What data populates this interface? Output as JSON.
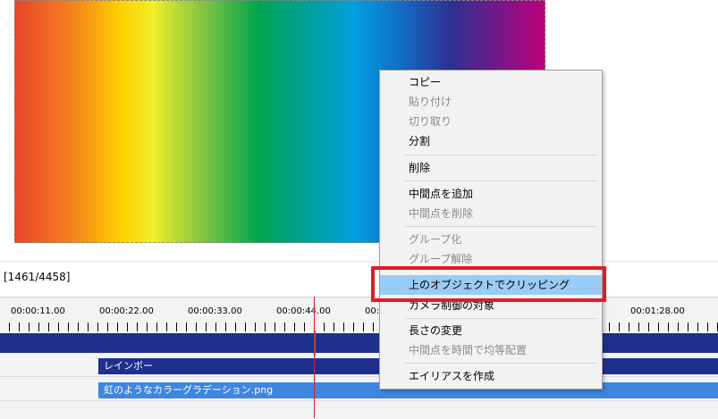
{
  "infobar": {
    "frame_counter": "[1461/4458]"
  },
  "ruler": {
    "labels": [
      "00:00:11.00",
      "00:00:22.00",
      "00:00:33.00",
      "00:00:44.00",
      "00:",
      "00:01:28.00"
    ]
  },
  "clips": {
    "rainbow": "レインボー",
    "png": "虹のようなカラーグラデーション.png"
  },
  "menu": {
    "items": [
      {
        "label": "コピー",
        "enabled": true
      },
      {
        "label": "貼り付け",
        "enabled": false
      },
      {
        "label": "切り取り",
        "enabled": false
      },
      {
        "label": "分割",
        "enabled": true
      },
      {
        "label": "削除",
        "enabled": true
      },
      {
        "label": "中間点を追加",
        "enabled": true
      },
      {
        "label": "中間点を削除",
        "enabled": false
      },
      {
        "label": "グループ化",
        "enabled": false
      },
      {
        "label": "グループ解除",
        "enabled": false
      },
      {
        "label": "上のオブジェクトでクリッピング",
        "enabled": true,
        "highlighted": true
      },
      {
        "label": "カメラ制御の対象",
        "enabled": true
      },
      {
        "label": "長さの変更",
        "enabled": true
      },
      {
        "label": "中間点を時間で均等配置",
        "enabled": false
      },
      {
        "label": "エイリアスを作成",
        "enabled": true
      }
    ]
  },
  "colors": {
    "highlight": "#99ccf5",
    "callout": "#e01c24",
    "layer_dark": "#1f2f8e",
    "layer_light": "#3f86e0",
    "playhead": "#d0202a"
  }
}
